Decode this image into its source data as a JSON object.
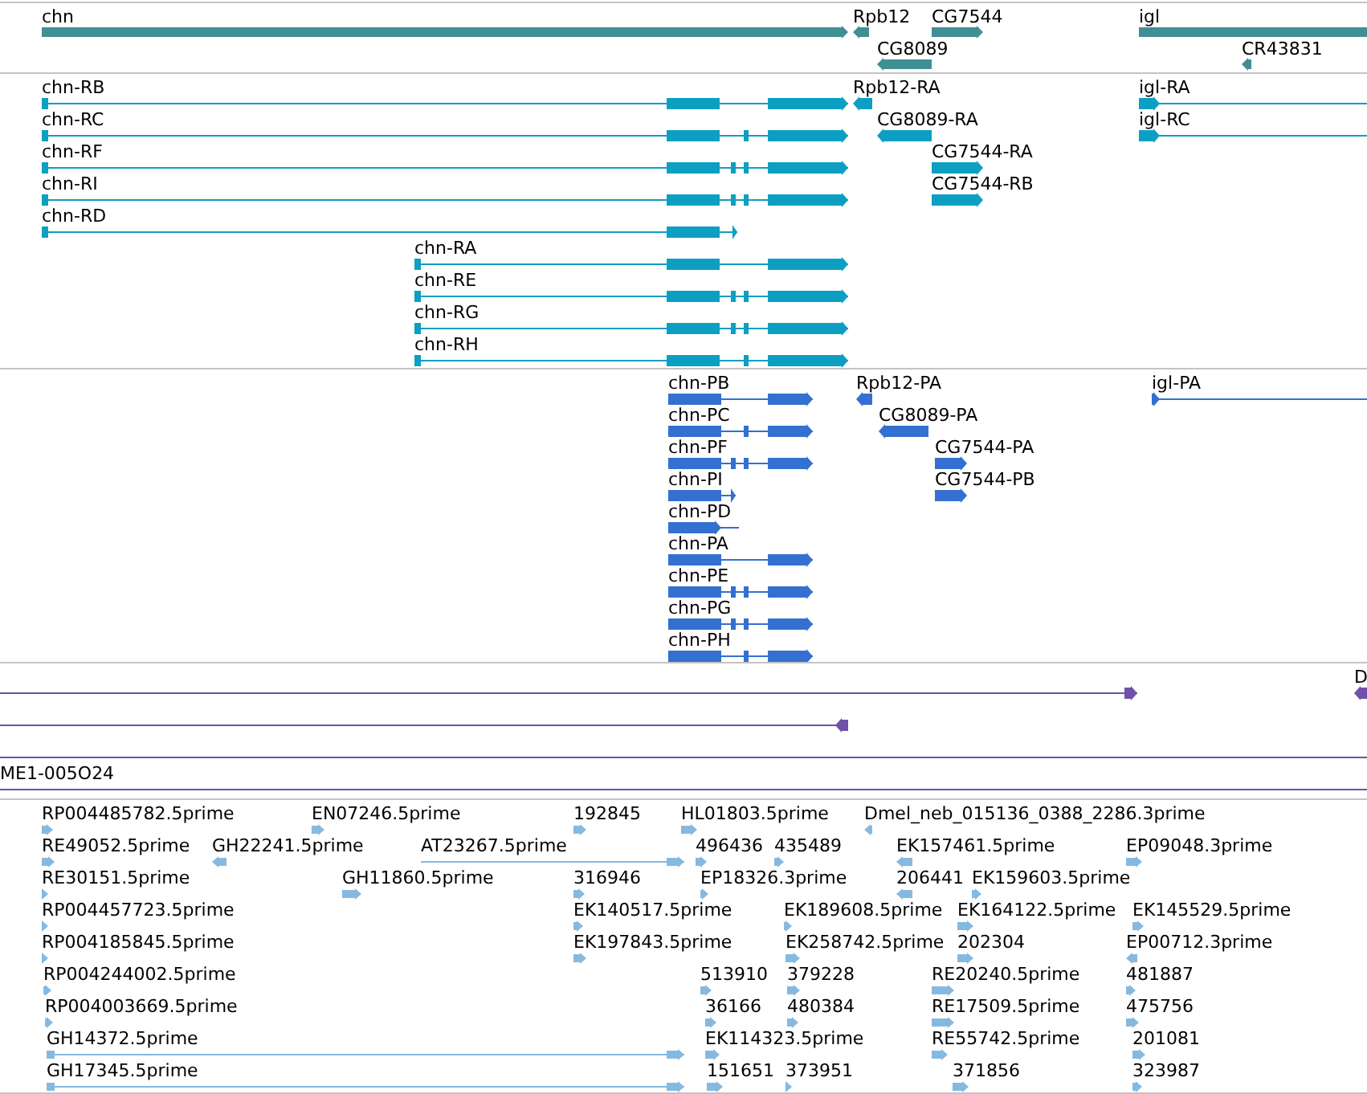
{
  "tracks": [
    {
      "kind": "gene",
      "color": "#3f8f94",
      "features": [
        {
          "label": "chn",
          "reverse": false
        },
        {
          "label": "Rpb12",
          "reverse": true
        },
        {
          "label": "CG7544",
          "reverse": false
        },
        {
          "label": "igl"
        },
        {
          "label": "CG8089",
          "reverse": true
        },
        {
          "label": "CR43831",
          "reverse": true
        }
      ]
    },
    {
      "kind": "transcript",
      "color": "#0d9fc2",
      "features": [
        {
          "label": "chn-RB",
          "reverse": false
        },
        {
          "label": "Rpb12-RA",
          "reverse": true
        },
        {
          "label": "igl-RA",
          "reverse": false
        },
        {
          "label": "chn-RC",
          "reverse": false
        },
        {
          "label": "CG8089-RA",
          "reverse": true
        },
        {
          "label": "igl-RC",
          "reverse": false
        },
        {
          "label": "chn-RF",
          "reverse": false
        },
        {
          "label": "CG7544-RA",
          "reverse": false
        },
        {
          "label": "chn-RI",
          "reverse": false
        },
        {
          "label": "CG7544-RB",
          "reverse": false
        },
        {
          "label": "chn-RD",
          "reverse": false
        },
        {
          "label": "chn-RA",
          "reverse": false
        },
        {
          "label": "chn-RE",
          "reverse": false
        },
        {
          "label": "chn-RG",
          "reverse": false
        },
        {
          "label": "chn-RH",
          "reverse": false
        }
      ]
    },
    {
      "kind": "protein",
      "color": "#3370d0",
      "features": [
        {
          "label": "chn-PB",
          "reverse": false
        },
        {
          "label": "Rpb12-PA",
          "reverse": true
        },
        {
          "label": "igl-PA",
          "reverse": false
        },
        {
          "label": "chn-PC",
          "reverse": false
        },
        {
          "label": "CG8089-PA",
          "reverse": true
        },
        {
          "label": "chn-PF",
          "reverse": false
        },
        {
          "label": "CG7544-PA",
          "reverse": false
        },
        {
          "label": "chn-PI",
          "reverse": false
        },
        {
          "label": "CG7544-PB",
          "reverse": false
        },
        {
          "label": "chn-PD",
          "reverse": false
        },
        {
          "label": "chn-PA",
          "reverse": false
        },
        {
          "label": "chn-PE",
          "reverse": false
        },
        {
          "label": "chn-PG",
          "reverse": false
        },
        {
          "label": "chn-PH",
          "reverse": false
        }
      ]
    },
    {
      "kind": "clone",
      "color": "#7050a8",
      "features": [
        {
          "kind": "directed",
          "reverse": false
        },
        {
          "kind": "directed",
          "label": "D",
          "reverse": true
        },
        {
          "kind": "directed",
          "reverse": true
        },
        {
          "kind": "span"
        },
        {
          "kind": "span",
          "label": "ME1-005O24"
        }
      ]
    },
    {
      "kind": "est",
      "color": "#86b9e0",
      "features": [
        {
          "label": "RP004485782.5prime",
          "reverse": false
        },
        {
          "label": "EN07246.5prime",
          "reverse": false
        },
        {
          "label": "192845",
          "reverse": false
        },
        {
          "label": "HL01803.5prime",
          "reverse": false
        },
        {
          "label": "Dmel_neb_015136_0388_2286.3prime",
          "reverse": true
        },
        {
          "label": "RE49052.5prime",
          "reverse": false
        },
        {
          "label": "GH22241.5prime",
          "reverse": true
        },
        {
          "label": "AT23267.5prime",
          "reverse": false
        },
        {
          "label": "496436",
          "reverse": false
        },
        {
          "label": "435489",
          "reverse": false
        },
        {
          "label": "EK157461.5prime",
          "reverse": true
        },
        {
          "label": "EP09048.3prime",
          "reverse": false
        },
        {
          "label": "RE30151.5prime",
          "reverse": false
        },
        {
          "label": "GH11860.5prime",
          "reverse": false
        },
        {
          "label": "316946",
          "reverse": false
        },
        {
          "label": "EP18326.3prime",
          "reverse": false
        },
        {
          "label": "206441",
          "reverse": true
        },
        {
          "label": "EK159603.5prime",
          "reverse": false
        },
        {
          "label": "RP004457723.5prime",
          "reverse": false
        },
        {
          "label": "EK140517.5prime",
          "reverse": false
        },
        {
          "label": "EK189608.5prime",
          "reverse": false
        },
        {
          "label": "EK164122.5prime",
          "reverse": false
        },
        {
          "label": "EK145529.5prime",
          "reverse": false
        },
        {
          "label": "RP004185845.5prime",
          "reverse": false
        },
        {
          "label": "EK197843.5prime",
          "reverse": false
        },
        {
          "label": "EK258742.5prime",
          "reverse": false
        },
        {
          "label": "202304",
          "reverse": false
        },
        {
          "label": "EP00712.3prime",
          "reverse": true
        },
        {
          "label": "RP004244002.5prime",
          "reverse": false
        },
        {
          "label": "513910",
          "reverse": false
        },
        {
          "label": "379228",
          "reverse": false
        },
        {
          "label": "RE20240.5prime",
          "reverse": false
        },
        {
          "label": "481887",
          "reverse": false
        },
        {
          "label": "RP004003669.5prime",
          "reverse": false
        },
        {
          "label": "36166",
          "reverse": false
        },
        {
          "label": "480384",
          "reverse": false
        },
        {
          "label": "RE17509.5prime",
          "reverse": false
        },
        {
          "label": "475756",
          "reverse": false
        },
        {
          "label": "GH14372.5prime",
          "reverse": false
        },
        {
          "label": "EK114323.5prime",
          "reverse": false
        },
        {
          "label": "RE55742.5prime",
          "reverse": false
        },
        {
          "label": "201081",
          "reverse": false
        },
        {
          "label": "GH17345.5prime",
          "reverse": false
        },
        {
          "label": "151651",
          "reverse": false
        },
        {
          "label": "373951",
          "reverse": false
        },
        {
          "label": "371856",
          "reverse": false
        },
        {
          "label": "323987",
          "reverse": false
        }
      ]
    }
  ]
}
